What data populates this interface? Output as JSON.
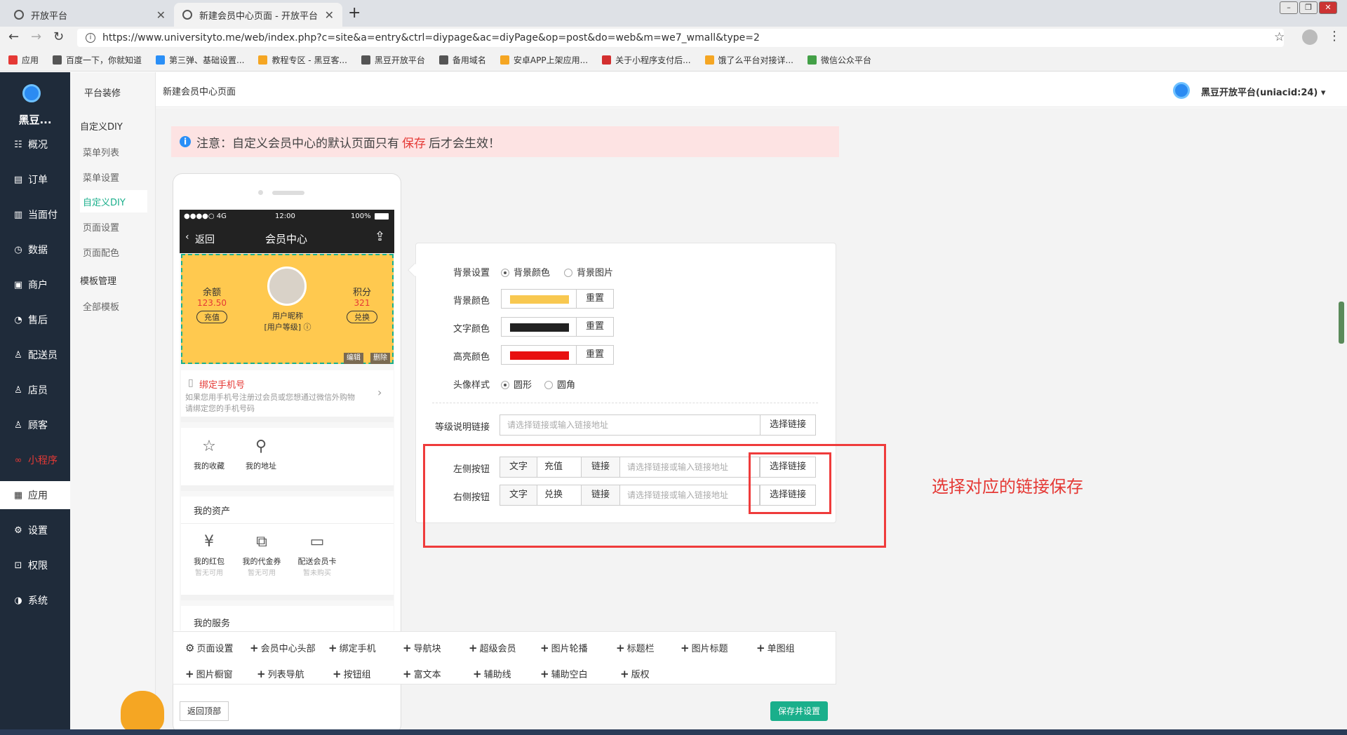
{
  "browser": {
    "tabs": [
      {
        "title": "开放平台",
        "active": false
      },
      {
        "title": "新建会员中心页面 - 开放平台",
        "active": true
      }
    ],
    "new_tab": "+",
    "url": "https://www.universityto.me/web/index.php?c=site&a=entry&ctrl=diypage&ac=diyPage&op=post&do=web&m=we7_wmall&type=2",
    "bookmarks": [
      {
        "label": "应用",
        "color": "#e53935"
      },
      {
        "label": "百度一下，你就知道",
        "color": "#555555"
      },
      {
        "label": "第三弹、基础设置...",
        "color": "#2a8ff7"
      },
      {
        "label": "教程专区 - 黑豆客...",
        "color": "#f5a623"
      },
      {
        "label": "黑豆开放平台",
        "color": "#555555"
      },
      {
        "label": "备用域名",
        "color": "#555555"
      },
      {
        "label": "安卓APP上架应用...",
        "color": "#f5a623"
      },
      {
        "label": "关于小程序支付后...",
        "color": "#d32f2f"
      },
      {
        "label": "饿了么平台对接详...",
        "color": "#f5a623"
      },
      {
        "label": "微信公众平台",
        "color": "#43a047"
      }
    ]
  },
  "sidebar": {
    "brand": "黑豆...",
    "items": [
      {
        "label": "概况",
        "icon": "overview-icon",
        "glyph": "☷"
      },
      {
        "label": "订单",
        "icon": "order-icon",
        "glyph": "▤"
      },
      {
        "label": "当面付",
        "icon": "pay-icon",
        "glyph": "▥"
      },
      {
        "label": "数据",
        "icon": "data-icon",
        "glyph": "◷"
      },
      {
        "label": "商户",
        "icon": "store-icon",
        "glyph": "▣"
      },
      {
        "label": "售后",
        "icon": "aftersale-icon",
        "glyph": "◔"
      },
      {
        "label": "配送员",
        "icon": "courier-icon",
        "glyph": "♙"
      },
      {
        "label": "店员",
        "icon": "clerk-icon",
        "glyph": "♙"
      },
      {
        "label": "顾客",
        "icon": "customer-icon",
        "glyph": "♙"
      },
      {
        "label": "小程序",
        "icon": "miniapp-icon",
        "glyph": "∞"
      },
      {
        "label": "应用",
        "icon": "app-icon",
        "glyph": "▦"
      },
      {
        "label": "设置",
        "icon": "settings-icon",
        "glyph": "⚙"
      },
      {
        "label": "权限",
        "icon": "lock-icon",
        "glyph": "⊡"
      },
      {
        "label": "系统",
        "icon": "system-icon",
        "glyph": "◑"
      }
    ]
  },
  "subnav": {
    "heading": "平台装修",
    "group1": "自定义DIY",
    "items1": [
      "菜单列表",
      "菜单设置",
      "自定义DIY",
      "页面设置",
      "页面配色"
    ],
    "group2": "模板管理",
    "items2": [
      "全部模板"
    ]
  },
  "header": {
    "title": "新建会员中心页面",
    "account": "黑豆开放平台(uniacid:24)"
  },
  "notice": {
    "prefix": "注意：自定义会员中心的默认页面只有",
    "highlight": "保存",
    "suffix": "后才会生效！"
  },
  "phone": {
    "status_left": "●●●●○ 4G",
    "status_time": "12:00",
    "status_right": "100%",
    "back": "返回",
    "title": "会员中心",
    "balance_label": "余额",
    "balance_value": "123.50",
    "recharge": "充值",
    "nickname": "用户昵称",
    "level": "[用户等级]",
    "points_label": "积分",
    "points_value": "321",
    "exchange": "兑换",
    "edit": "编辑",
    "delete": "删除",
    "bind_title": "绑定手机号",
    "bind_desc1": "如果您用手机号注册过会员或您想通过微信外购物",
    "bind_desc2": "请绑定您的手机号码",
    "fav": "我的收藏",
    "address": "我的地址",
    "assets_title": "我的资产",
    "assets": [
      {
        "label": "我的红包",
        "sub": "暂无可用"
      },
      {
        "label": "我的代金券",
        "sub": "暂无可用"
      },
      {
        "label": "配送会员卡",
        "sub": "暂未购买"
      }
    ],
    "services_title": "我的服务"
  },
  "panel": {
    "bg_label": "背景设置",
    "bg_opt1": "背景颜色",
    "bg_opt2": "背景图片",
    "bgcolor_label": "背景颜色",
    "textcolor_label": "文字颜色",
    "hlcolor_label": "高亮颜色",
    "reset": "重置",
    "avatar_label": "头像样式",
    "avatar_opt1": "圆形",
    "avatar_opt2": "圆角",
    "level_link_label": "等级说明链接",
    "link_placeholder": "请选择链接或输入链接地址",
    "choose_link": "选择链接",
    "left_btn_label": "左侧按钮",
    "right_btn_label": "右侧按钮",
    "text_seg": "文字",
    "left_text": "充值",
    "right_text": "兑换",
    "link_seg": "链接",
    "colors": {
      "bg": "#f8c850",
      "text": "#222222",
      "highlight": "#e81010"
    }
  },
  "annotation": "选择对应的链接保存",
  "toolbar": {
    "row1": [
      "页面设置",
      "会员中心头部",
      "绑定手机",
      "导航块",
      "超级会员",
      "图片轮播",
      "标题栏",
      "图片标题",
      "单图组"
    ],
    "row2": [
      "图片橱窗",
      "列表导航",
      "按钮组",
      "富文本",
      "辅助线",
      "辅助空白",
      "版权"
    ]
  },
  "footer": {
    "back_top": "返回顶部",
    "save": "保存并设置"
  }
}
